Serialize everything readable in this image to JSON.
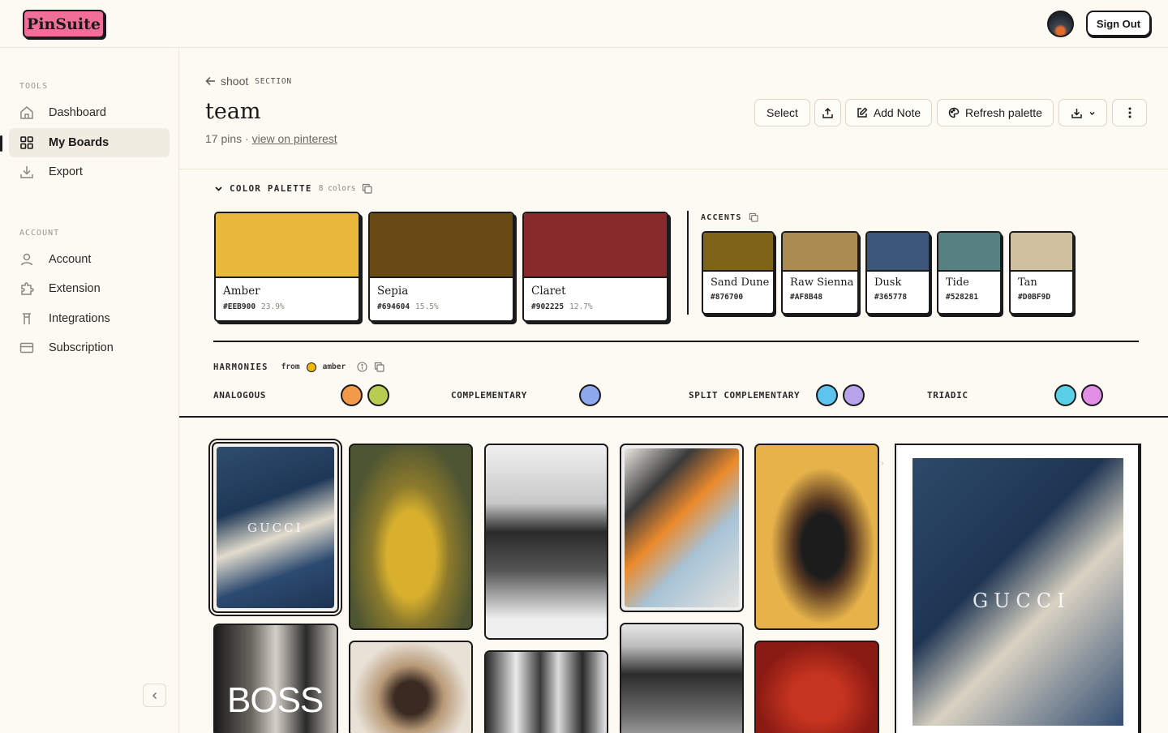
{
  "app": {
    "logo": "PinSuite",
    "sign_out": "Sign Out"
  },
  "sidebar": {
    "tools_label": "TOOLS",
    "account_label": "ACCOUNT",
    "items": [
      {
        "label": "Dashboard",
        "icon": "home-icon"
      },
      {
        "label": "My Boards",
        "icon": "grid-icon"
      },
      {
        "label": "Export",
        "icon": "download-icon"
      },
      {
        "label": "Account",
        "icon": "user-icon"
      },
      {
        "label": "Extension",
        "icon": "puzzle-icon"
      },
      {
        "label": "Integrations",
        "icon": "plug-icon"
      },
      {
        "label": "Subscription",
        "icon": "card-icon"
      }
    ]
  },
  "header": {
    "back_label": "shoot",
    "back_tag": "SECTION",
    "title": "team",
    "pins_count": "17 pins",
    "separator": "·",
    "link": "view on pinterest"
  },
  "toolbar": {
    "select": "Select",
    "add_note": "Add Note",
    "refresh": "Refresh palette"
  },
  "palette": {
    "label": "COLOR PALETTE",
    "count": "8 colors",
    "main": [
      {
        "name": "Amber",
        "hex": "#EEB900",
        "pct": "23.9%",
        "color": "#e8b93a"
      },
      {
        "name": "Sepia",
        "hex": "#694604",
        "pct": "15.5%",
        "color": "#6a4a14"
      },
      {
        "name": "Claret",
        "hex": "#902225",
        "pct": "12.7%",
        "color": "#882a2b"
      }
    ],
    "accents_label": "ACCENTS",
    "accents": [
      {
        "name": "Sand Dune",
        "hex": "#876700",
        "color": "#7d6418"
      },
      {
        "name": "Raw Sienna",
        "hex": "#AF8B48",
        "color": "#ab8b4f"
      },
      {
        "name": "Dusk",
        "hex": "#365778",
        "color": "#3b5678"
      },
      {
        "name": "Tide",
        "hex": "#528281",
        "color": "#568180"
      },
      {
        "name": "Tan",
        "hex": "#D0BF9D",
        "color": "#cebf9f"
      }
    ]
  },
  "harmonies": {
    "label": "HARMONIES",
    "from": "from",
    "base": "amber",
    "groups": [
      {
        "label": "ANALOGOUS",
        "colors": [
          "#f29a4a",
          "#b9cc52"
        ]
      },
      {
        "label": "COMPLEMENTARY",
        "colors": [
          "#8ea8ee"
        ]
      },
      {
        "label": "SPLIT COMPLEMENTARY",
        "colors": [
          "#5ec3ee",
          "#b8a2ec"
        ]
      },
      {
        "label": "TRIADIC",
        "colors": [
          "#5ad0e6",
          "#e28ee6"
        ]
      }
    ]
  },
  "pins": {
    "overlay_texts": [
      "GUCCI",
      "BOSS",
      "GUCCI"
    ]
  }
}
